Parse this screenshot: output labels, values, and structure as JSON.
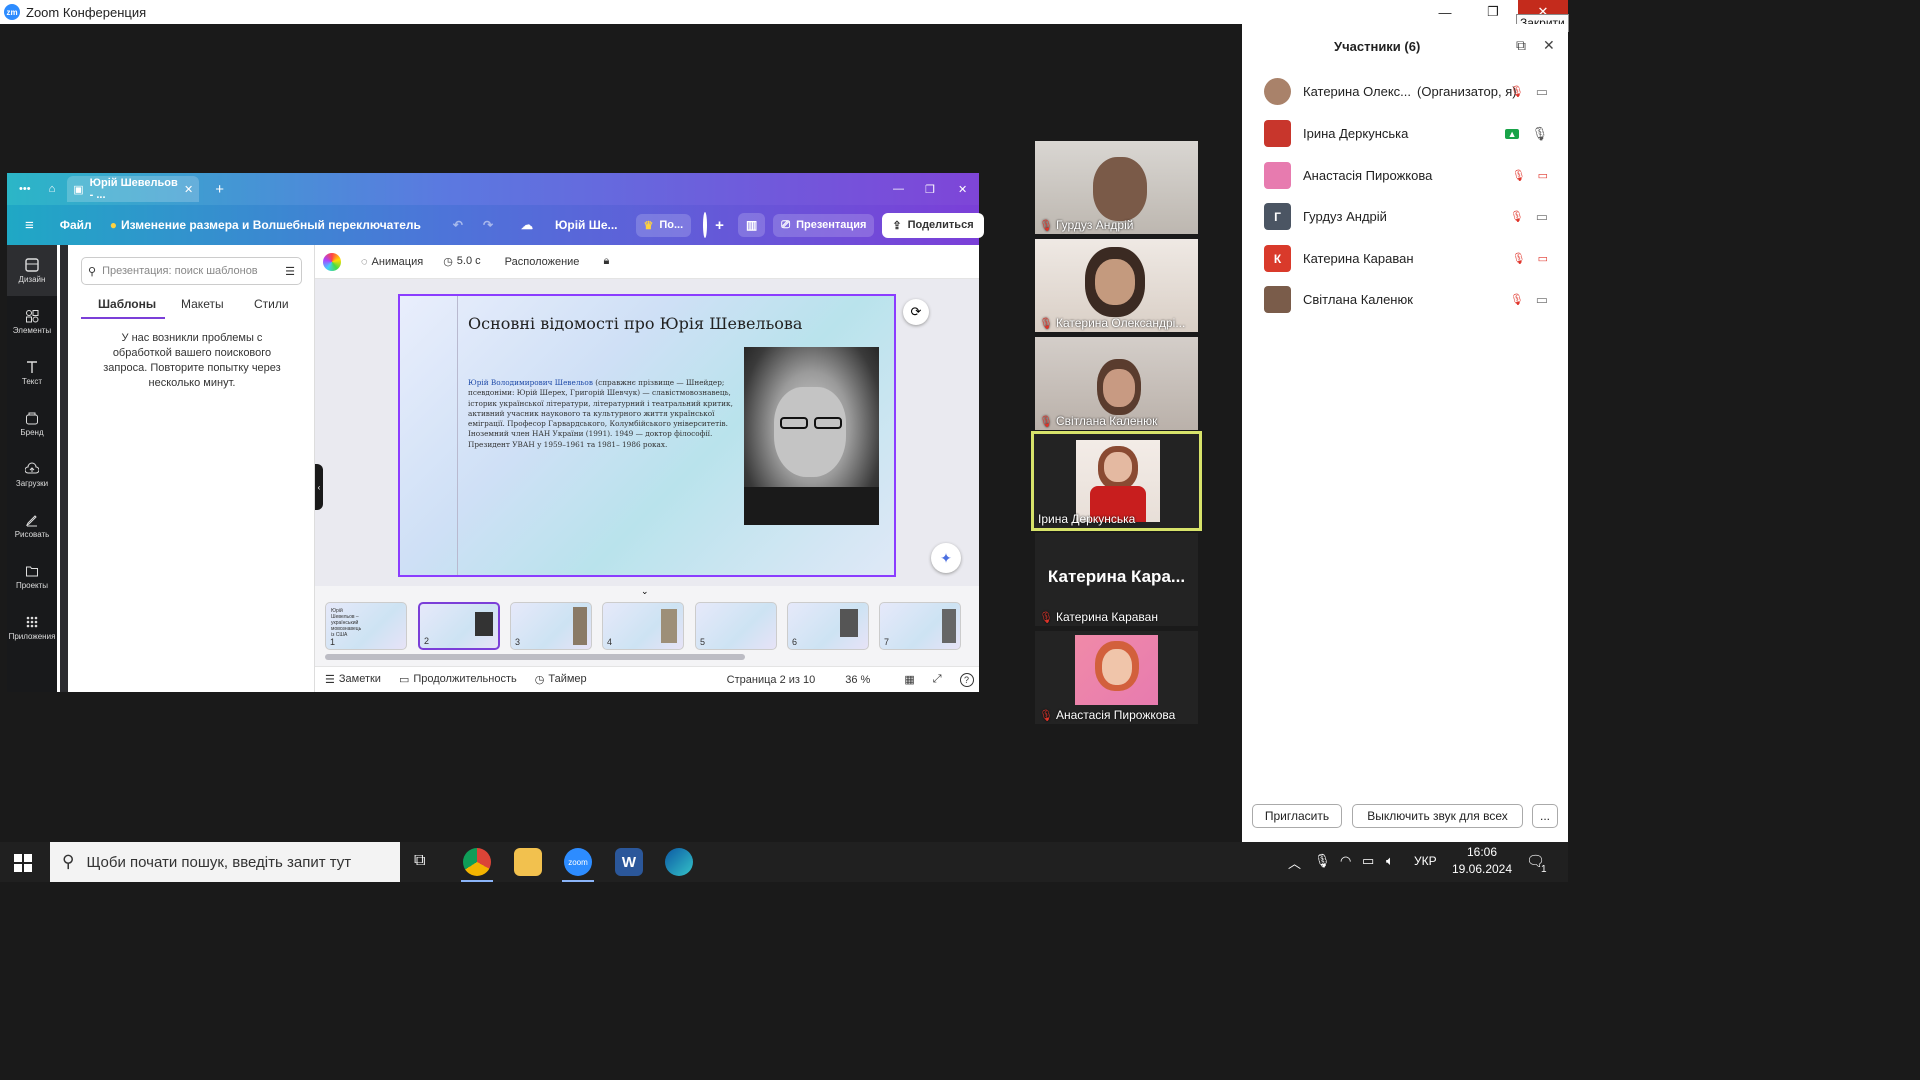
{
  "window": {
    "app_title": "Zoom Конференция",
    "close_tooltip": "Закрити",
    "minimize": "—",
    "maximize": "❐",
    "close": "✕"
  },
  "canva": {
    "tab_title": "Юрій Шевельов - ...",
    "menu": "Файл",
    "resize": "Изменение размера и Волшебный переключатель",
    "doc_title": "Юрій Ше...",
    "upgrade": "По...",
    "present": "Презентация",
    "share": "Поделиться",
    "rail": [
      "Дизайн",
      "Элементы",
      "Текст",
      "Бренд",
      "Загрузки",
      "Рисовать",
      "Проекты",
      "Приложения"
    ],
    "search_placeholder": "Презентация: поиск шаблонов",
    "panel_tabs": [
      "Шаблоны",
      "Макеты",
      "Стили"
    ],
    "error": "У нас возникли проблемы с обработкой вашего поискового запроса. Повторите попытку через несколько минут.",
    "toolbar": {
      "animation": "Анимация",
      "duration": "5.0 с",
      "arrange": "Расположение"
    },
    "slide": {
      "title": "Основні відомості про Юрія Шевельова",
      "body_highlight": "Юрій Володимирович Шевельов",
      "body": " (справжнє прізвище — Шнейдер; псевдоніми: Юрій Шерех, Григорій Шевчук) — славістмовознавець, історик української літератури, літературний і театральний критик, активний учасник наукового та культурного життя української еміграції. Професор Гарвардського, Колумбійського університетів. Іноземний член НАН України (1991). 1949 — доктор філософії. Президент УВАН у 1959–1961 та 1981– 1986 роках."
    },
    "thumbs": [
      "1",
      "2",
      "3",
      "4",
      "5",
      "6",
      "7"
    ],
    "thumb1_title": "Юрій Шевельов – український мовознавець із США",
    "bottom": {
      "notes": "Заметки",
      "duration": "Продолжительность",
      "timer": "Таймер",
      "page": "Страница 2 из 10",
      "zoom": "36 %"
    }
  },
  "videos": [
    {
      "name": "Гурдуз Андрій"
    },
    {
      "name": "Катерина Олександрі..."
    },
    {
      "name": "Світлана Каленюк"
    },
    {
      "name": "Ірина Деркунська"
    },
    {
      "big": "Катерина  Кара...",
      "name": "Катерина Караван"
    },
    {
      "name": "Анастасія Пирожкова"
    }
  ],
  "participants": {
    "title": "Участники (6)",
    "list": [
      {
        "name": "Катерина Олекс...",
        "role": "(Организатор, я)"
      },
      {
        "name": "Ірина Деркунська"
      },
      {
        "name": "Анастасія Пирожкова"
      },
      {
        "name": "Гурдуз Андрій",
        "initial": "Г"
      },
      {
        "name": "Катерина Караван",
        "initial": "К"
      },
      {
        "name": "Світлана Каленюк"
      }
    ],
    "invite": "Пригласить",
    "mute_all": "Выключить звук для всех",
    "more": "..."
  },
  "taskbar": {
    "search": "Щоби почати пошук, введіть запит тут",
    "lang": "УКР",
    "time": "16:06",
    "date": "19.06.2024",
    "notif": "1"
  }
}
